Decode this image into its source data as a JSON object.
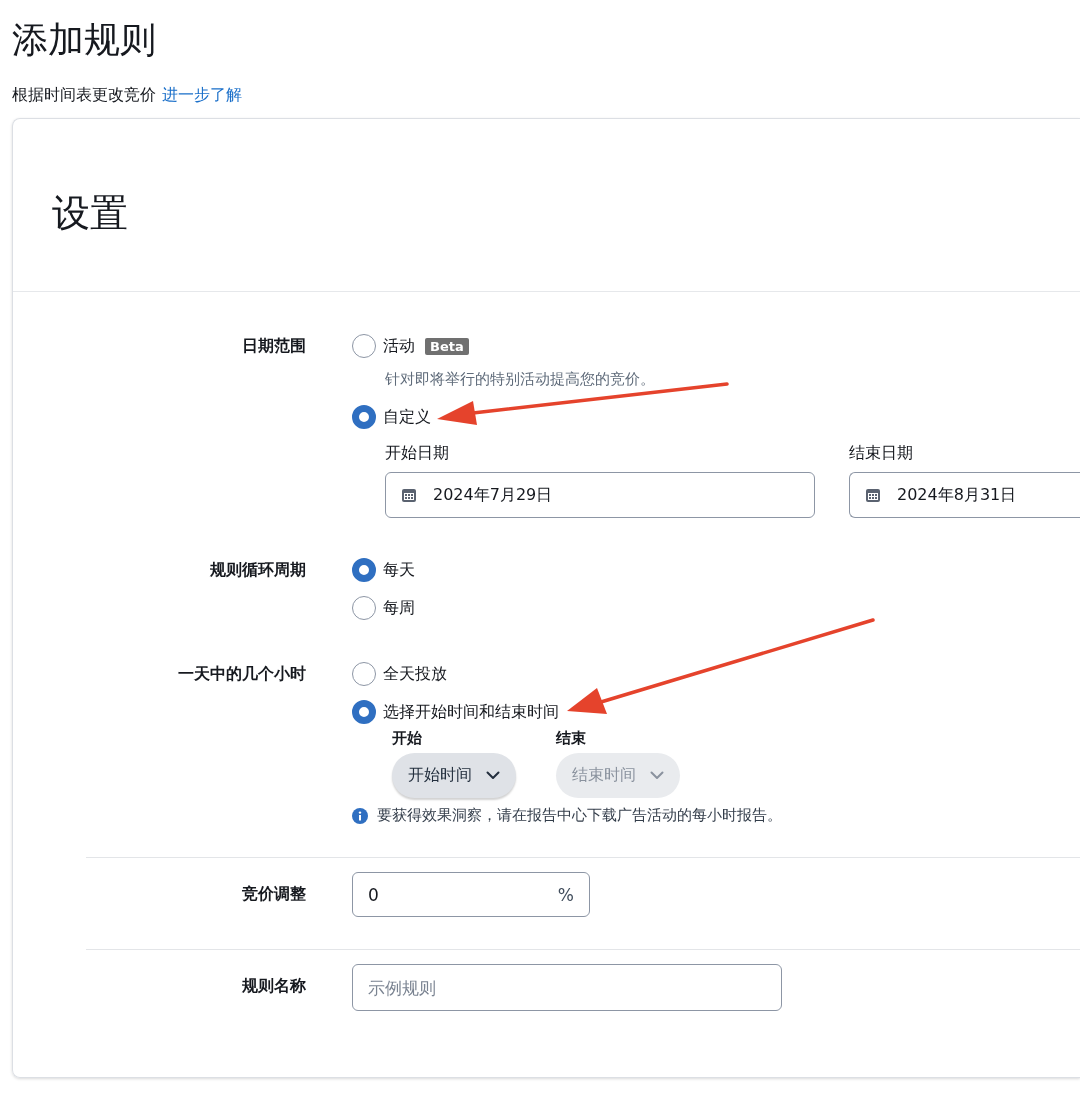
{
  "page": {
    "title": "添加规则",
    "subtitle": "根据时间表更改竞价",
    "learn_more_link": "进一步了解"
  },
  "card": {
    "title": "设置",
    "sections": [
      {
        "kind": "date_range",
        "label": "日期范围",
        "divided": false,
        "options": [
          {
            "label": "活动",
            "badge": "Beta",
            "description": "针对即将举行的特别活动提高您的竞价。",
            "selected": false,
            "arrow": false
          },
          {
            "label": "自定义",
            "selected": true,
            "arrow": true
          }
        ],
        "start_date": {
          "label": "开始日期",
          "value": "2024年7月29日"
        },
        "end_date": {
          "label": "结束日期",
          "value": "2024年8月31日"
        }
      },
      {
        "kind": "radios",
        "label": "规则循环周期",
        "divided": false,
        "options": [
          {
            "label": "每天",
            "selected": true,
            "arrow": false
          },
          {
            "label": "每周",
            "selected": false,
            "arrow": false
          }
        ]
      },
      {
        "kind": "hours",
        "label": "一天中的几个小时",
        "divided": false,
        "options": [
          {
            "label": "全天投放",
            "selected": false,
            "arrow": false
          },
          {
            "label": "选择开始时间和结束时间",
            "selected": true,
            "arrow": true
          }
        ],
        "start": {
          "label": "开始",
          "text": "开始时间",
          "disabled": false
        },
        "end": {
          "label": "结束",
          "text": "结束时间",
          "disabled": true
        },
        "info": "要获得效果洞察，请在报告中心下载广告活动的每小时报告。"
      },
      {
        "kind": "percent",
        "label": "竞价调整",
        "divided": true,
        "value": "0",
        "unit": "%"
      },
      {
        "kind": "text",
        "label": "规则名称",
        "divided": true,
        "placeholder": "示例规则"
      }
    ]
  }
}
